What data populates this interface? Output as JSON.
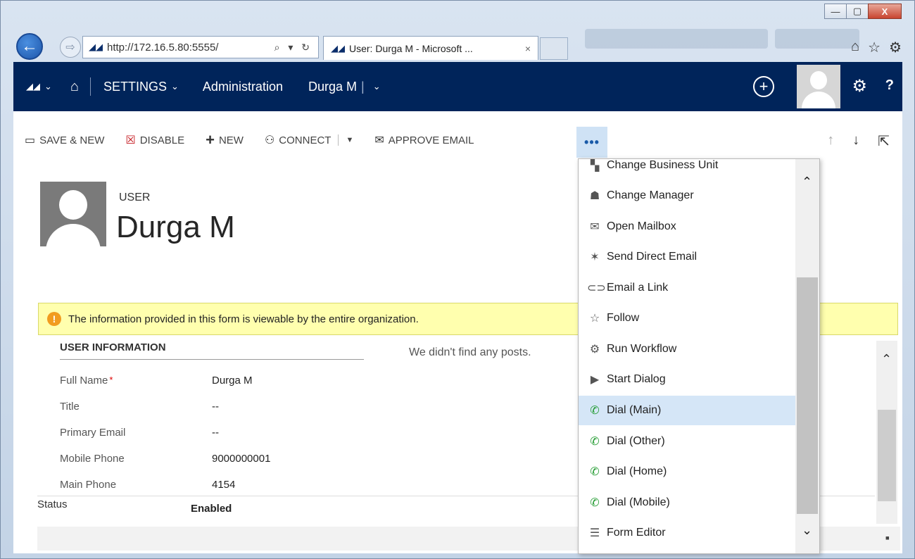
{
  "browser": {
    "url": "http://172.16.5.80:5555/",
    "url_controls": "⌕ ▾ ↻",
    "tab_title": "User: Durga M - Microsoft ...",
    "tab_close": "×",
    "window_controls": [
      "—",
      "▢",
      "X"
    ]
  },
  "topbar": {
    "settings_label": "SETTINGS",
    "administration_label": "Administration",
    "record_label": "Durga M"
  },
  "command_bar": {
    "save_new": "SAVE & NEW",
    "disable": "DISABLE",
    "new": "NEW",
    "connect": "CONNECT",
    "approve_email": "APPROVE EMAIL",
    "more": "•••"
  },
  "header": {
    "entity": "USER",
    "name": "Durga M"
  },
  "notice": {
    "text": "The information provided in this form is viewable by the entire organization."
  },
  "form": {
    "section_title": "USER INFORMATION",
    "posts_empty": "We didn't find any posts.",
    "fields": [
      {
        "label": "Full Name",
        "value": "Durga M",
        "required": "*"
      },
      {
        "label": "Title",
        "value": "--"
      },
      {
        "label": "Primary Email",
        "value": "--"
      },
      {
        "label": "Mobile Phone",
        "value": "9000000001"
      },
      {
        "label": "Main Phone",
        "value": "4154"
      }
    ],
    "status_label": "Status",
    "status_value": "Enabled"
  },
  "menu": {
    "items": [
      {
        "label": "Change Business Unit",
        "icon": "business-unit-icon"
      },
      {
        "label": "Change Manager",
        "icon": "manager-icon"
      },
      {
        "label": "Open Mailbox",
        "icon": "mailbox-icon"
      },
      {
        "label": "Send Direct Email",
        "icon": "wand-icon"
      },
      {
        "label": "Email a Link",
        "icon": "link-icon"
      },
      {
        "label": "Follow",
        "icon": "star-icon"
      },
      {
        "label": "Run Workflow",
        "icon": "workflow-icon"
      },
      {
        "label": "Start Dialog",
        "icon": "play-icon"
      },
      {
        "label": "Dial (Main)",
        "icon": "phone-icon",
        "selected": true
      },
      {
        "label": "Dial (Other)",
        "icon": "phone-icon"
      },
      {
        "label": "Dial (Home)",
        "icon": "phone-icon"
      },
      {
        "label": "Dial (Mobile)",
        "icon": "phone-icon"
      },
      {
        "label": "Form Editor",
        "icon": "form-icon"
      }
    ]
  },
  "colors": {
    "nav_bar": "#00245a",
    "notice_bg": "#ffffae",
    "selected_item": "#d5e6f7",
    "phone_icon": "#1f9a2e"
  }
}
